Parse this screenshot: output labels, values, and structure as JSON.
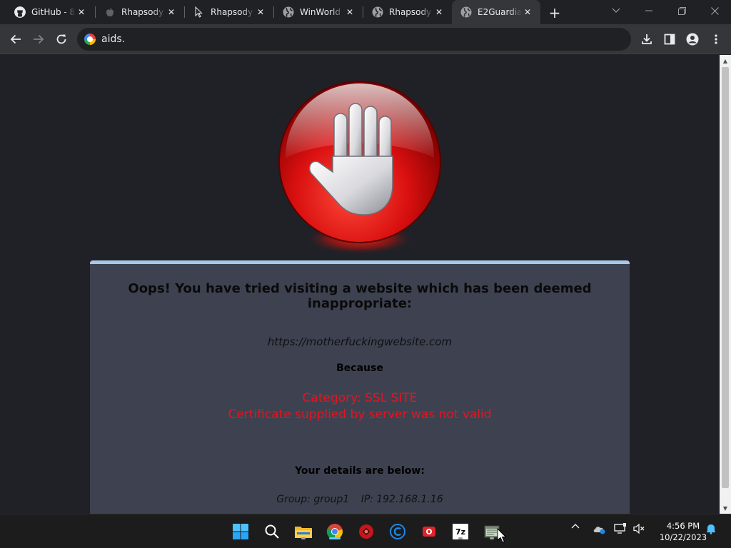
{
  "browser": {
    "tabs": [
      {
        "title": "GitHub - 8",
        "icon": "github-icon",
        "active": false
      },
      {
        "title": "Rhapsody",
        "icon": "apple-icon",
        "active": false
      },
      {
        "title": "Rhapsody",
        "icon": "loading-icon",
        "active": false
      },
      {
        "title": "WinWorld",
        "icon": "globe-icon",
        "active": false
      },
      {
        "title": "Rhapsody",
        "icon": "globe-icon",
        "active": false
      },
      {
        "title": "E2Guardia",
        "icon": "globe-icon",
        "active": true
      }
    ],
    "tab_close_glyph": "✕",
    "new_tab_glyph": "+",
    "address_bar": {
      "value": "aids.",
      "icon": "google-icon"
    }
  },
  "block_page": {
    "headline": "Oops! You have tried visiting a website which has been deemed inappropriate:",
    "blocked_url": "https://motherfuckingwebsite.com",
    "because_label": "Because",
    "category": "Category: SSL SITE",
    "reason": "Certificate supplied by server was not valid",
    "details_title": "Your details are below:",
    "group": "Group: group1",
    "ip": "IP: 192.168.1.16",
    "accent_color": "#e8131f"
  },
  "taskbar": {
    "apps": [
      "start-icon",
      "search-icon",
      "file-explorer-icon",
      "chrome-icon",
      "app-red-icon",
      "app-blue-c-icon",
      "app-recorder-icon",
      "7zip-icon",
      "app-window-icon"
    ],
    "seven_zip_label": "7z",
    "clock": {
      "time": "4:56 PM",
      "date": "10/22/2023"
    }
  }
}
